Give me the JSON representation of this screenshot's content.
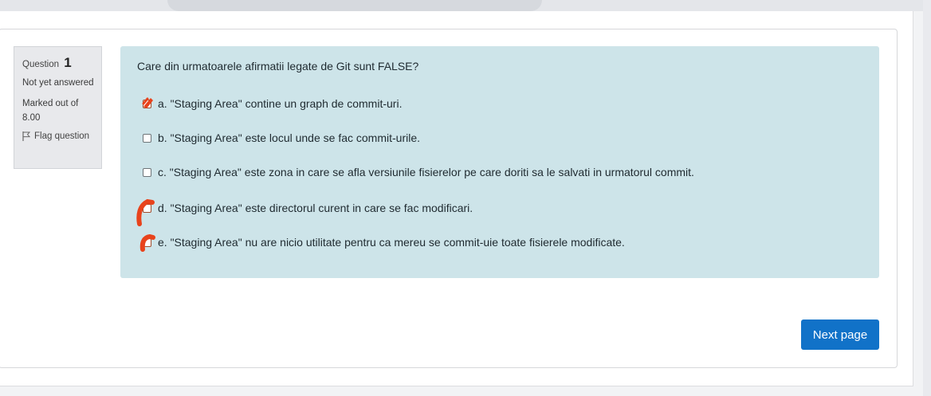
{
  "question": {
    "label": "Question",
    "number": "1",
    "status": "Not yet answered",
    "marks": "Marked out of 8.00",
    "flag_label": "Flag question",
    "text": "Care din urmatoarele afirmatii legate de Git sunt FALSE?",
    "options": [
      {
        "letter": "a.",
        "text": "\"Staging Area\" contine un graph de commit-uri.",
        "marked": true
      },
      {
        "letter": "b.",
        "text": "\"Staging Area\" este locul unde se fac commit-urile.",
        "marked": false
      },
      {
        "letter": "c.",
        "text": "\"Staging Area\" este zona in care se afla versiunile fisierelor pe care doriti sa le salvati in urmatorul commit.",
        "marked": false
      },
      {
        "letter": "d.",
        "text": "\"Staging Area\" este directorul curent in care se fac modificari.",
        "marked": true
      },
      {
        "letter": "e.",
        "text": "\"Staging Area\" nu are nicio utilitate pentru ca mereu se commit-uie toate fisierele modificate.",
        "marked": true
      }
    ]
  },
  "navigation": {
    "next_label": "Next page"
  },
  "colors": {
    "formulation_bg": "#cde4e9",
    "info_bg": "#e8e9ec",
    "primary_button": "#1172c8",
    "scribble": "#e8431c"
  }
}
